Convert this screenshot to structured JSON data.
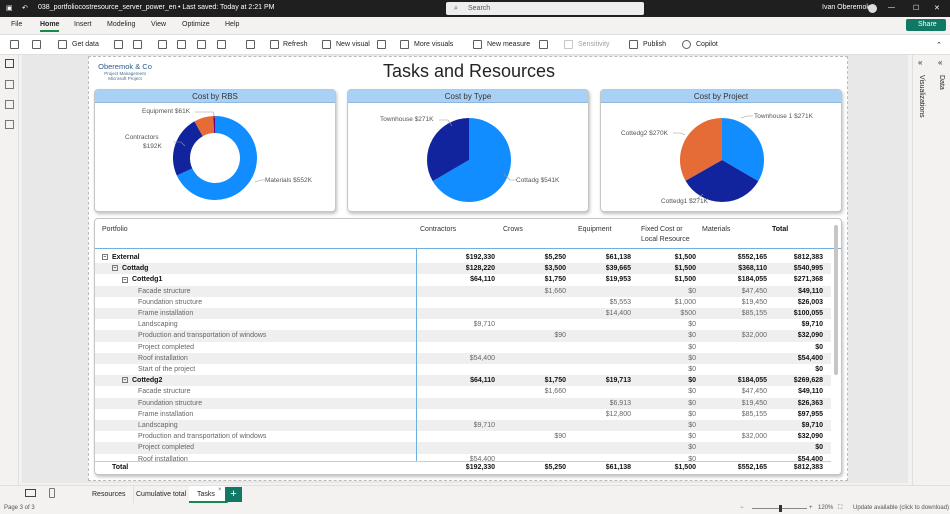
{
  "titlebar": {
    "filename": "038_portfoliocostresource_server_power_en",
    "saved": "• Last saved: Today at 2:21 PM",
    "user": "Ivan Oberemok"
  },
  "search": {
    "placeholder": "Search"
  },
  "menu": [
    "File",
    "Home",
    "Insert",
    "Modeling",
    "View",
    "Optimize",
    "Help"
  ],
  "share_label": "Share",
  "ribbon": {
    "get_data": "Get data",
    "refresh": "Refresh",
    "new_visual": "New visual",
    "more_visuals": "More visuals",
    "new_measure": "New measure",
    "sensitivity": "Sensitivity",
    "publish": "Publish",
    "copilot": "Copilot"
  },
  "rightpane": {
    "data": "Data",
    "visualizations": "Visualizations"
  },
  "report": {
    "logo_line1": "Oberemok & Co",
    "logo_line2": "Project Management",
    "logo_line3": "Microsoft Project",
    "title": "Tasks and Resources"
  },
  "donut": {
    "title": "Cost by RBS",
    "labels": [
      "Equipment $61K",
      "Contractors",
      "$192K",
      "Materials $552K"
    ],
    "slices": [
      {
        "name": "Materials",
        "value": 552,
        "color": "#118dff"
      },
      {
        "name": "Contractors",
        "value": 192,
        "color": "#12239e"
      },
      {
        "name": "Equipment",
        "value": 61,
        "color": "#e66c37"
      },
      {
        "name": "Crows",
        "value": 5,
        "color": "#6b007b"
      }
    ]
  },
  "pie_type": {
    "title": "Cost by Type",
    "labels": [
      "Townhouse $271K",
      "Cottadg $541K"
    ],
    "slices": [
      {
        "name": "Cottadg",
        "value": 541,
        "color": "#118dff"
      },
      {
        "name": "Townhouse",
        "value": 271,
        "color": "#12239e"
      }
    ]
  },
  "pie_project": {
    "title": "Cost by Project",
    "labels": [
      "Townhouse 1 $271K",
      "Cottedg2 $270K",
      "Cottedg1 $271K"
    ],
    "slices": [
      {
        "name": "Townhouse 1",
        "value": 271,
        "color": "#118dff"
      },
      {
        "name": "Cottedg1",
        "value": 271,
        "color": "#12239e"
      },
      {
        "name": "Cottedg2",
        "value": 270,
        "color": "#e66c37"
      }
    ]
  },
  "matrix": {
    "headers": [
      "Portfolio",
      "Contractors",
      "Crows",
      "Equipment",
      "Fixed Cost or",
      "Local Resource",
      "Materials",
      "Total"
    ],
    "rows": [
      {
        "label": "External",
        "indent": 0,
        "tog": "−",
        "bold": true,
        "vals": [
          "$192,330",
          "$5,250",
          "$61,138",
          "$1,500",
          "$552,165",
          "$812,383"
        ]
      },
      {
        "label": "Cottadg",
        "indent": 1,
        "tog": "−",
        "bold": true,
        "vals": [
          "$128,220",
          "$3,500",
          "$39,665",
          "$1,500",
          "$368,110",
          "$540,995"
        ]
      },
      {
        "label": "Cottedg1",
        "indent": 2,
        "tog": "−",
        "bold": true,
        "vals": [
          "$64,110",
          "$1,750",
          "$19,953",
          "$1,500",
          "$184,055",
          "$271,368"
        ]
      },
      {
        "label": "Facade structure",
        "indent": 3,
        "tog": "",
        "bold": false,
        "vals": [
          "",
          "$1,660",
          "",
          "$0",
          "$47,450",
          "$49,110"
        ]
      },
      {
        "label": "Foundation structure",
        "indent": 3,
        "tog": "",
        "bold": false,
        "vals": [
          "",
          "",
          "$5,553",
          "$1,000",
          "$19,450",
          "$26,003"
        ]
      },
      {
        "label": "Frame installation",
        "indent": 3,
        "tog": "",
        "bold": false,
        "vals": [
          "",
          "",
          "$14,400",
          "$500",
          "$85,155",
          "$100,055"
        ]
      },
      {
        "label": "Landscaping",
        "indent": 3,
        "tog": "",
        "bold": false,
        "vals": [
          "$9,710",
          "",
          "",
          "$0",
          "",
          "$9,710"
        ]
      },
      {
        "label": "Production and transportation of windows",
        "indent": 3,
        "tog": "",
        "bold": false,
        "vals": [
          "",
          "$90",
          "",
          "$0",
          "$32,000",
          "$32,090"
        ]
      },
      {
        "label": "Project completed",
        "indent": 3,
        "tog": "",
        "bold": false,
        "vals": [
          "",
          "",
          "",
          "$0",
          "",
          "$0"
        ]
      },
      {
        "label": "Roof installation",
        "indent": 3,
        "tog": "",
        "bold": false,
        "vals": [
          "$54,400",
          "",
          "",
          "$0",
          "",
          "$54,400"
        ]
      },
      {
        "label": "Start of the project",
        "indent": 3,
        "tog": "",
        "bold": false,
        "vals": [
          "",
          "",
          "",
          "$0",
          "",
          "$0"
        ]
      },
      {
        "label": "Cottedg2",
        "indent": 2,
        "tog": "−",
        "bold": true,
        "vals": [
          "$64,110",
          "$1,750",
          "$19,713",
          "$0",
          "$184,055",
          "$269,628"
        ]
      },
      {
        "label": "Facade structure",
        "indent": 3,
        "tog": "",
        "bold": false,
        "vals": [
          "",
          "$1,660",
          "",
          "$0",
          "$47,450",
          "$49,110"
        ]
      },
      {
        "label": "Foundation structure",
        "indent": 3,
        "tog": "",
        "bold": false,
        "vals": [
          "",
          "",
          "$6,913",
          "$0",
          "$19,450",
          "$26,363"
        ]
      },
      {
        "label": "Frame installation",
        "indent": 3,
        "tog": "",
        "bold": false,
        "vals": [
          "",
          "",
          "$12,800",
          "$0",
          "$85,155",
          "$97,955"
        ]
      },
      {
        "label": "Landscaping",
        "indent": 3,
        "tog": "",
        "bold": false,
        "vals": [
          "$9,710",
          "",
          "",
          "$0",
          "",
          "$9,710"
        ]
      },
      {
        "label": "Production and transportation of windows",
        "indent": 3,
        "tog": "",
        "bold": false,
        "vals": [
          "",
          "$90",
          "",
          "$0",
          "$32,000",
          "$32,090"
        ]
      },
      {
        "label": "Project completed",
        "indent": 3,
        "tog": "",
        "bold": false,
        "vals": [
          "",
          "",
          "",
          "$0",
          "",
          "$0"
        ]
      },
      {
        "label": "Roof installation",
        "indent": 3,
        "tog": "",
        "bold": false,
        "vals": [
          "$54,400",
          "",
          "",
          "$0",
          "",
          "$54,400"
        ]
      }
    ],
    "total": {
      "label": "Total",
      "vals": [
        "$192,330",
        "$5,250",
        "$61,138",
        "$1,500",
        "$552,165",
        "$812,383"
      ]
    }
  },
  "pages": [
    "Resources",
    "Cumulative total",
    "Tasks"
  ],
  "status": {
    "page": "Page 3 of 3",
    "zoom": "120%",
    "update": "Update available (click to download)"
  }
}
